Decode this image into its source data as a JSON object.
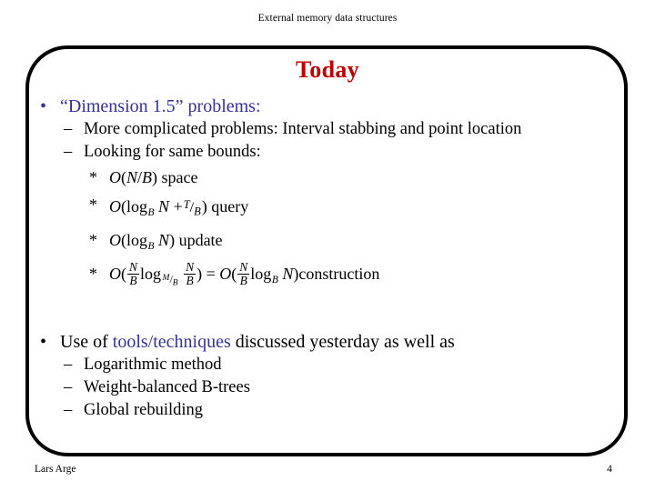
{
  "slide": {
    "header": "External memory data structures",
    "title": "Today",
    "accent_color": "#333399",
    "title_color": "#c00000",
    "frame_color": "#000000"
  },
  "bullets": {
    "b1": {
      "marker": "•",
      "text": "“Dimension 1.5” problems:",
      "color": "#333399"
    },
    "b1_sub1": {
      "marker": "–",
      "text": "More complicated problems: Interval stabbing and point location"
    },
    "b1_sub2": {
      "marker": "–",
      "text": "Looking for same bounds:"
    },
    "star1": {
      "marker": "*",
      "formula": "O(N/B)",
      "trailing": "space",
      "parts": {
        "o": "O",
        "lparen": "(",
        "num": "N",
        "slash": "/",
        "den": "B",
        "rparen": ")"
      }
    },
    "star2": {
      "marker": "*",
      "formula": "O(log_B N + T/B)",
      "trailing": "query",
      "parts": {
        "o": "O",
        "lparen": "(",
        "log": "log",
        "logsub": "B",
        "n": "N",
        "plus": "+",
        "fnum": "T",
        "fslash": "/",
        "fden": "B",
        "rparen": ")"
      }
    },
    "star3": {
      "marker": "*",
      "formula": "O(log_B N)",
      "trailing": "update",
      "parts": {
        "o": "O",
        "lparen": "(",
        "log": "log",
        "logsub": "B",
        "n": "N",
        "rparen": ")"
      }
    },
    "star4": {
      "marker": "*",
      "formula": "O(N/B log_{M/B} N/B) = O(N/B log_B N)",
      "trailing": "construction",
      "parts": {
        "o1": "O",
        "lparen1": "(",
        "f1num": "N",
        "f1den": "B",
        "log1": "log",
        "subM": "M",
        "subslash": "/",
        "subB": "B",
        "f2num": "N",
        "f2den": "B",
        "rparen1": ")",
        "equals": "=",
        "o2": "O",
        "lparen2": "(",
        "f3num": "N",
        "f3den": "B",
        "log2": "log",
        "log2sub": "B",
        "n2": "N",
        "rparen2": ")"
      }
    },
    "b2": {
      "marker": "•",
      "pre": "Use of ",
      "accent": "tools/techniques",
      "post": " discussed yesterday as well as"
    },
    "b2_sub1": {
      "marker": "–",
      "text": "Logarithmic method"
    },
    "b2_sub2": {
      "marker": "–",
      "text": "Weight-balanced B-trees"
    },
    "b2_sub3": {
      "marker": "–",
      "text": "Global rebuilding"
    }
  },
  "footer": {
    "author": "Lars Arge",
    "page_number": "4"
  }
}
